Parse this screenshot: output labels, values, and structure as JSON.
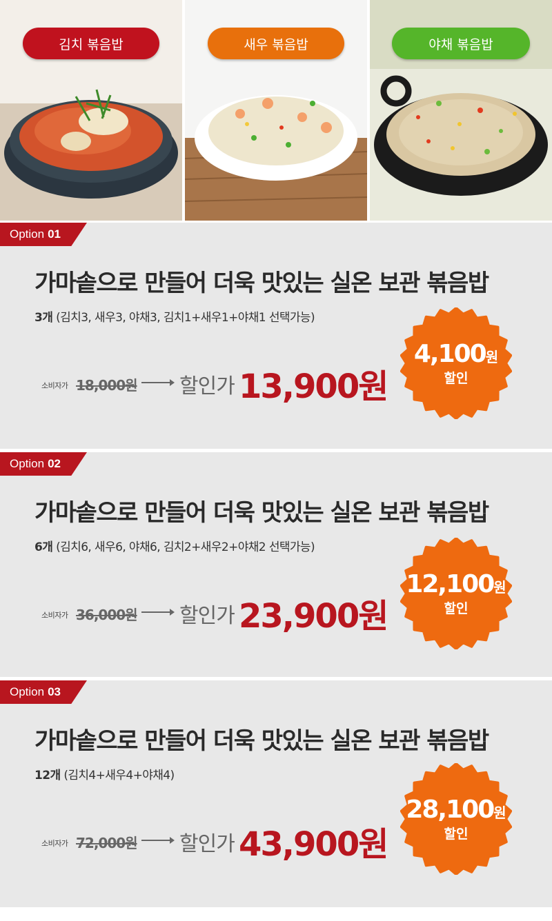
{
  "products": [
    {
      "label": "김치 볶음밥",
      "color": "#c0121e"
    },
    {
      "label": "새우 볶음밥",
      "color": "#e8700c"
    },
    {
      "label": "야채 볶음밥",
      "color": "#55b52a"
    }
  ],
  "options": [
    {
      "tab_prefix": "Option",
      "tab_num": "01",
      "title": "가마솥으로 만들어 더욱 맛있는 실온 보관 볶음밥",
      "count": "3개",
      "detail": "(김치3, 새우3, 야채3, 김치1+새우1+야채1 선택가능)",
      "consumer_label": "소비자가",
      "original_price": "18,000원",
      "sale_label": "할인가",
      "sale_price": "13,900원",
      "discount_amount": "4,100",
      "discount_won": "원",
      "discount_label": "할인"
    },
    {
      "tab_prefix": "Option",
      "tab_num": "02",
      "title": "가마솥으로 만들어 더욱 맛있는 실온 보관 볶음밥",
      "count": "6개",
      "detail": "(김치6, 새우6, 야채6, 김치2+새우2+야채2 선택가능)",
      "consumer_label": "소비자가",
      "original_price": "36,000원",
      "sale_label": "할인가",
      "sale_price": "23,900원",
      "discount_amount": "12,100",
      "discount_won": "원",
      "discount_label": "할인"
    },
    {
      "tab_prefix": "Option",
      "tab_num": "03",
      "title": "가마솥으로 만들어 더욱 맛있는 실온 보관 볶음밥",
      "count": "12개",
      "detail": "(김치4+새우4+야채4)",
      "consumer_label": "소비자가",
      "original_price": "72,000원",
      "sale_label": "할인가",
      "sale_price": "43,900원",
      "discount_amount": "28,100",
      "discount_won": "원",
      "discount_label": "할인"
    }
  ],
  "colors": {
    "accent_red": "#b8161f",
    "badge_orange": "#ee6a10",
    "section_bg": "#e8e8e8"
  }
}
